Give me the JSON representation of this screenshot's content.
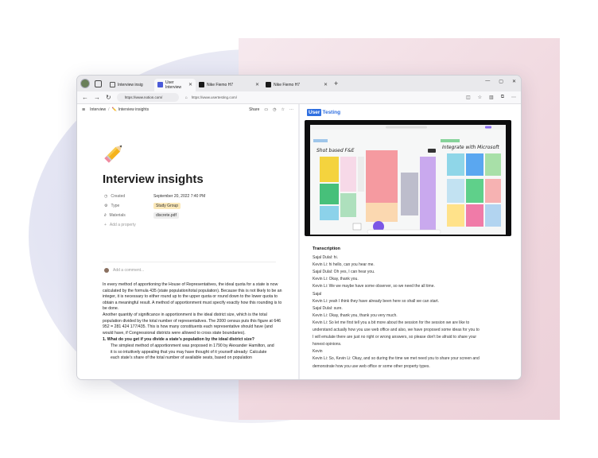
{
  "browser": {
    "tabs": [
      {
        "label": "Interview insig",
        "active": false,
        "favicon_color": "#e8e8ea"
      },
      {
        "label": "User Interview",
        "active": true,
        "favicon_color": "#4a5ad8"
      },
      {
        "label": "Nike Fiemo H7",
        "active": false,
        "favicon_color": "#1a1a1a"
      },
      {
        "label": "Nike Fiemo H7",
        "active": false,
        "favicon_color": "#1a1a1a"
      }
    ],
    "url_left": "https://www.notion.com/",
    "url_right": "https://www.usertesting.com/"
  },
  "notion": {
    "breadcrumb_root": "Interview",
    "breadcrumb_page": "Interview insights",
    "share_label": "Share",
    "title": "Interview insights",
    "properties": [
      {
        "label": "Created",
        "value": "September 20, 2022 7:40 PM",
        "icon": "clock-icon",
        "style": "plain"
      },
      {
        "label": "Type",
        "value": "Study Group",
        "icon": "gear-icon",
        "style": "tag"
      },
      {
        "label": "Materials",
        "value": "discrete.pdf",
        "icon": "paperclip-icon",
        "style": "file"
      }
    ],
    "add_property": "Add a property",
    "add_comment": "Add a comment...",
    "paragraphs": [
      "In every method of apportioning the House of Representatives, the ideal quota for a state is now calculated by the formula 435 (state population/total population). Because this is not likely to be an integer, it is necessary to either round up to the upper quota or round down to the lower quota to obtain a meaningful result. A method of apportionment must specify exactly how this rounding is to be done.",
      "Another quantity of significance in apportionment is the ideal district size, which is the total population divided by the total number of representatives. The 2000 census puts this figure at 646 952 = 281 424 177/435. This is how many constituents each representative should have (and would have, if Congressional districts were allowed to cross state boundaries)."
    ],
    "question": "1.  What do you get if you divide a state’s population by the ideal district size?",
    "answer_lines": [
      "The simplest method of apportionment was proposed in 1790 by Alexander Hamilton, and",
      "it is so intuitively appealing that you may have thought of it yourself already: Calculate",
      "each state’s share of the total number of available seats, based on population"
    ]
  },
  "usertesting": {
    "logo_box": "User",
    "logo_rest": "Testing",
    "video": {
      "board_left_title": "Shot based F&E",
      "board_right_title": "Integrate with Microsoft"
    },
    "transcript_title": "Transcription",
    "lines": [
      "Sajal Dulal: hi.",
      "Kevin Li: hi hello, can you hear me.",
      "Sajal Dulal: Oh yes, I can hear you.",
      "Kevin Li: Okay, thank you.",
      "Kevin Li: We we maybe have some observer, so we need the all time.",
      "Sajal",
      "Kevin Li: yeah I think they have already been here so shall we can start.",
      "Sajal Dulal: sure.",
      "Kevin Li: Okay, thank you, thank you very much.",
      "Kevin Li: So let me first tell you a bit more about the session for the session we are like to",
      "understand actually how you use web office and also, we have proposed some ideas for you to",
      "I will emulate there are just no right or wrong answers, so please don't be afraid to share your",
      "honest opinions.",
      "Kevin",
      "Kevin Li: So, Kevin Li: Okay, and so during the time we met need you to share your screen and",
      "demonstrate how you use web office or some other property types."
    ]
  }
}
